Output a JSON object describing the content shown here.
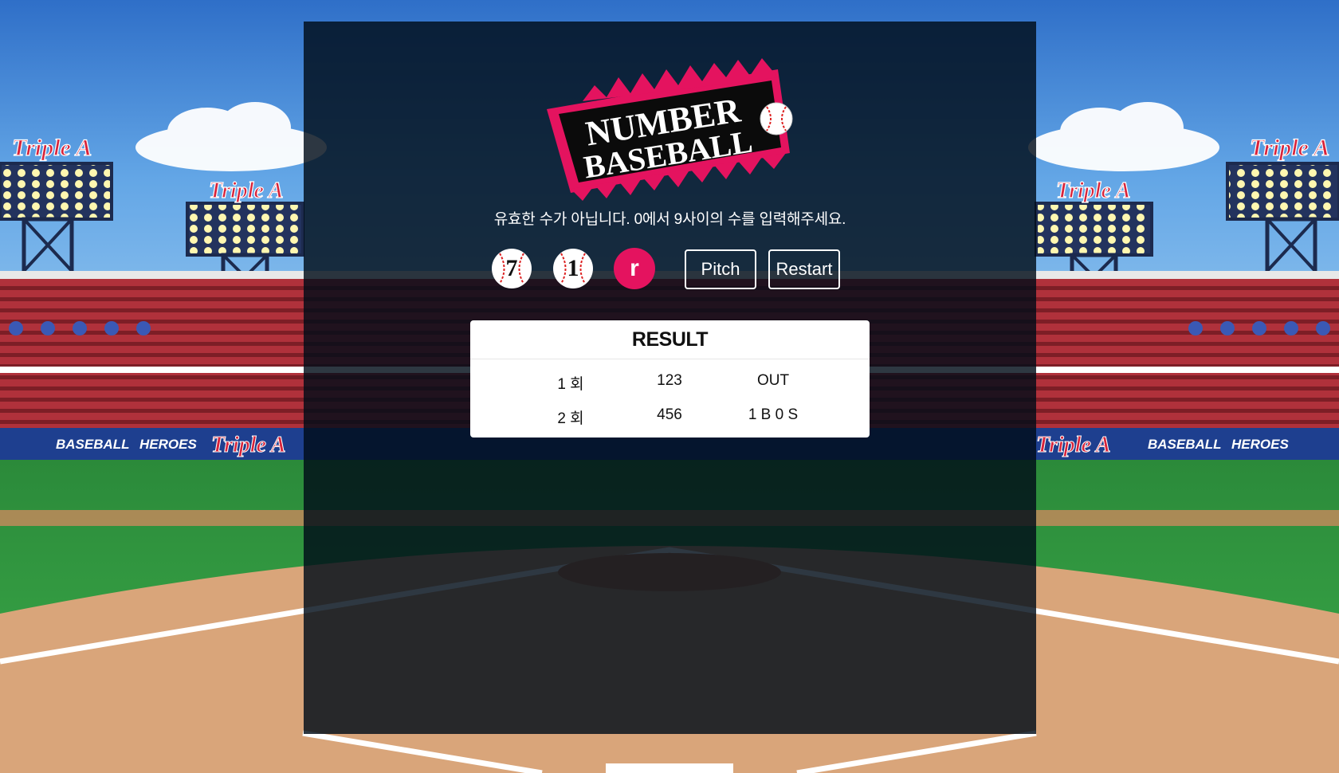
{
  "game": {
    "logo_line1": "NUMBER",
    "logo_line2": "BASEBALL",
    "message": "유효한 수가 아닙니다. 0에서 9사이의 수를 입력해주세요.",
    "balls": [
      {
        "value": "7",
        "state": "filled"
      },
      {
        "value": "1",
        "state": "filled"
      },
      {
        "value": "r",
        "state": "active"
      }
    ],
    "pitch_label": "Pitch",
    "restart_label": "Restart"
  },
  "result": {
    "title": "RESULT",
    "rows": [
      {
        "inning": "1 회",
        "guess": "123",
        "outcome": "OUT"
      },
      {
        "inning": "2 회",
        "guess": "456",
        "outcome": "1 B 0 S"
      }
    ]
  },
  "background": {
    "banner_brand": "BASEBALL",
    "banner_brand2": "HEROES",
    "team_sign": "Triple A"
  },
  "colors": {
    "accent": "#e4135f",
    "sky": "#3a7fd0",
    "grass": "#2f9a3e",
    "panel": "#000c18"
  }
}
